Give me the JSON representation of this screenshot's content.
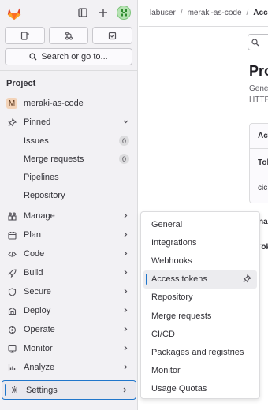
{
  "colors": {
    "accent": "#1f75cb",
    "sidebar_bg": "#f2f1f4",
    "logo": "#e24329"
  },
  "sidebar": {
    "icons": {
      "toggle": "sidebar-toggle-icon",
      "new": "plus-icon",
      "avatar": "user-avatar"
    },
    "quick_actions": [
      "issues-icon",
      "merge-request-icon",
      "todo-icon"
    ],
    "search_label": "Search or go to...",
    "section_title": "Project",
    "project": {
      "initial": "M",
      "name": "meraki-as-code"
    },
    "pinned": {
      "label": "Pinned",
      "items": [
        {
          "label": "Issues",
          "count": "0"
        },
        {
          "label": "Merge requests",
          "count": "0"
        },
        {
          "label": "Pipelines"
        },
        {
          "label": "Repository"
        }
      ]
    },
    "nav": [
      {
        "label": "Manage",
        "icon": "manage-icon"
      },
      {
        "label": "Plan",
        "icon": "plan-icon"
      },
      {
        "label": "Code",
        "icon": "code-icon"
      },
      {
        "label": "Build",
        "icon": "rocket-icon"
      },
      {
        "label": "Secure",
        "icon": "shield-icon"
      },
      {
        "label": "Deploy",
        "icon": "deploy-icon"
      },
      {
        "label": "Operate",
        "icon": "operate-icon"
      },
      {
        "label": "Monitor",
        "icon": "monitor-icon"
      },
      {
        "label": "Analyze",
        "icon": "chart-icon"
      }
    ],
    "settings_label": "Settings"
  },
  "breadcrumb": {
    "user": "labuser",
    "project": "meraki-as-code",
    "current": "Access"
  },
  "main": {
    "title": "Pro",
    "desc_line1": "Gene",
    "desc_line2": "HTTP",
    "card_head": "Act",
    "card_row1": "Tok",
    "card_row2": "cic",
    "frag1": "na",
    "frag2": "Tok"
  },
  "flyout": {
    "items": [
      {
        "label": "General"
      },
      {
        "label": "Integrations"
      },
      {
        "label": "Webhooks"
      },
      {
        "label": "Access tokens",
        "active": true
      },
      {
        "label": "Repository"
      },
      {
        "label": "Merge requests"
      },
      {
        "label": "CI/CD"
      },
      {
        "label": "Packages and registries"
      },
      {
        "label": "Monitor"
      },
      {
        "label": "Usage Quotas"
      }
    ]
  }
}
